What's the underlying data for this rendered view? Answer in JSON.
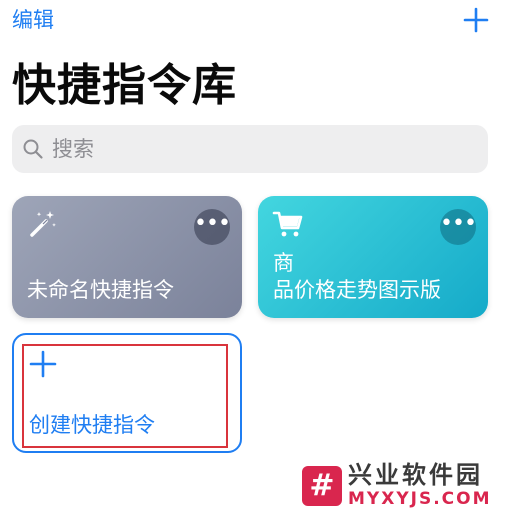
{
  "header": {
    "edit_label": "编辑",
    "add_icon": "plus-icon",
    "title": "快捷指令库"
  },
  "search": {
    "placeholder": "搜索",
    "icon": "search-icon"
  },
  "shortcuts": [
    {
      "title": "未命名快捷指令",
      "icon": "magic-wand-icon",
      "more_icon": "ellipsis-icon",
      "color_start": "#9ea5b8",
      "color_end": "#7b829a"
    },
    {
      "title_line1": "商",
      "title_line2": "品价格走势图示版",
      "icon": "shopping-cart-icon",
      "more_icon": "ellipsis-icon",
      "color_start": "#43d6df",
      "color_end": "#15aac9"
    }
  ],
  "create": {
    "label": "创建快捷指令",
    "icon": "plus-icon"
  },
  "colors": {
    "accent": "#1f7ef2",
    "highlight": "#d9343c",
    "watermark": "#d9264e"
  },
  "watermark": {
    "logo_symbol": "#",
    "name": "兴业软件园",
    "url": "MYXYJS.COM"
  }
}
